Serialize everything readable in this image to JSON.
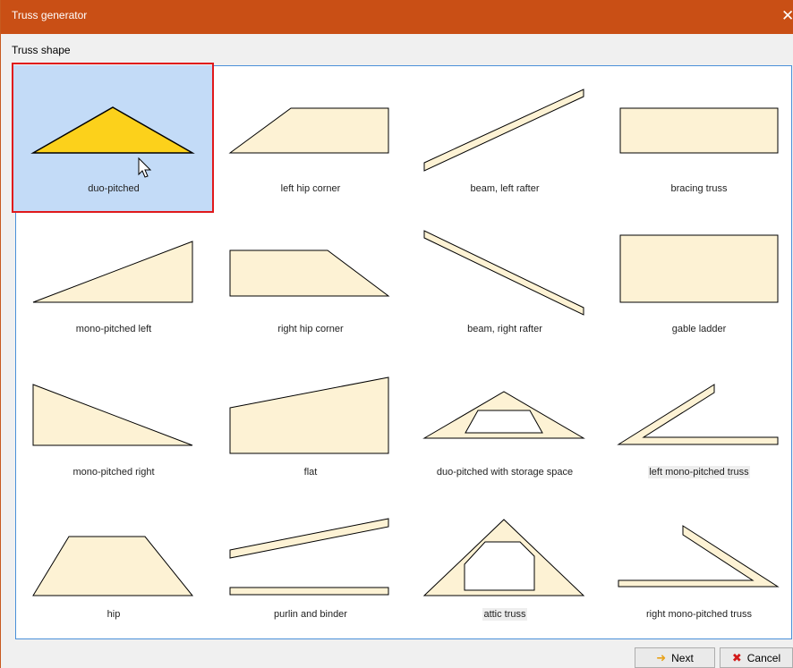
{
  "window": {
    "title": "Truss generator",
    "close_symbol": "✕"
  },
  "section": {
    "label": "Truss shape"
  },
  "selected_shape": "duo-pitched",
  "shapes": [
    {
      "label": "duo-pitched",
      "icon": "duo-pitched-shape-icon"
    },
    {
      "label": "left hip corner",
      "icon": "left-hip-corner-shape-icon"
    },
    {
      "label": "beam, left rafter",
      "icon": "beam-left-rafter-shape-icon"
    },
    {
      "label": "bracing truss",
      "icon": "bracing-truss-shape-icon"
    },
    {
      "label": "mono-pitched left",
      "icon": "mono-pitched-left-shape-icon"
    },
    {
      "label": "right hip corner",
      "icon": "right-hip-corner-shape-icon"
    },
    {
      "label": "beam, right rafter",
      "icon": "beam-right-rafter-shape-icon"
    },
    {
      "label": "gable ladder",
      "icon": "gable-ladder-shape-icon"
    },
    {
      "label": "mono-pitched right",
      "icon": "mono-pitched-right-shape-icon"
    },
    {
      "label": "flat",
      "icon": "flat-shape-icon"
    },
    {
      "label": "duo-pitched with storage space",
      "icon": "duo-pitched-storage-shape-icon"
    },
    {
      "label": "left mono-pitched truss",
      "icon": "left-mono-pitched-truss-shape-icon"
    },
    {
      "label": "hip",
      "icon": "hip-shape-icon"
    },
    {
      "label": "purlin and binder",
      "icon": "purlin-and-binder-shape-icon"
    },
    {
      "label": "attic truss",
      "icon": "attic-truss-shape-icon"
    },
    {
      "label": "right mono-pitched truss",
      "icon": "right-mono-pitched-truss-shape-icon"
    }
  ],
  "colors": {
    "titlebar": "#c94f15",
    "shape_fill": "#fdf2d4",
    "selected_fill": "#fcd11b",
    "selection_bg": "#c3dbf7",
    "selection_outline": "#e0191c",
    "panel_border": "#4a90d9"
  },
  "buttons": {
    "next_label": "Next",
    "next_icon": "arrow-right-icon",
    "cancel_label": "Cancel",
    "cancel_icon": "red-x-icon"
  }
}
